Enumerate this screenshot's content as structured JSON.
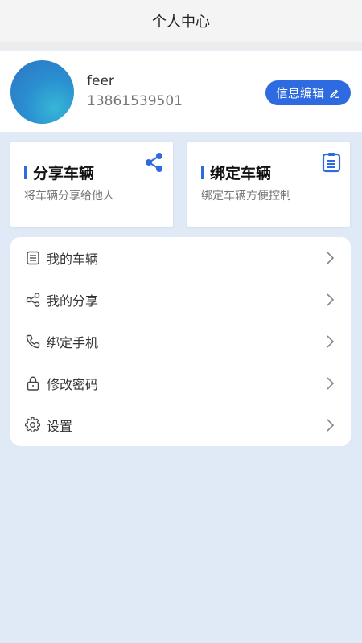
{
  "header": {
    "title": "个人中心"
  },
  "profile": {
    "name": "feer",
    "phone": "13861539501",
    "edit_label": "信息编辑"
  },
  "cards": [
    {
      "title": "分享车辆",
      "subtitle": "将车辆分享给他人",
      "icon": "share-icon"
    },
    {
      "title": "绑定车辆",
      "subtitle": "绑定车辆方便控制",
      "icon": "clipboard-icon"
    }
  ],
  "menu": {
    "items": [
      {
        "label": "我的车辆",
        "icon": "list-icon"
      },
      {
        "label": "我的分享",
        "icon": "share-icon"
      },
      {
        "label": "绑定手机",
        "icon": "phone-icon"
      },
      {
        "label": "修改密码",
        "icon": "lock-icon"
      },
      {
        "label": "设置",
        "icon": "gear-icon"
      }
    ]
  },
  "colors": {
    "accent": "#2e6be0",
    "background": "#dfeaf6"
  }
}
